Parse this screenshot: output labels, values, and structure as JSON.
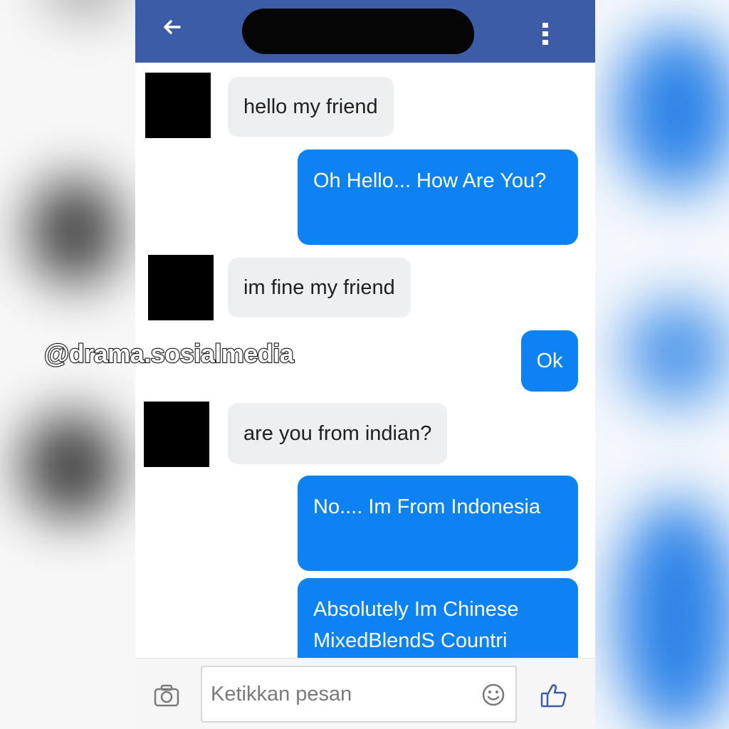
{
  "conversation": {
    "messages": [
      {
        "sender": "contact",
        "text": "hello my friend"
      },
      {
        "sender": "me",
        "text": "Oh Hello... How Are You?"
      },
      {
        "sender": "contact",
        "text": "im fine my friend"
      },
      {
        "sender": "me",
        "text": "Ok"
      },
      {
        "sender": "contact",
        "text": "are you from indian?"
      },
      {
        "sender": "me",
        "text": "No.... Im From Indonesia"
      },
      {
        "sender": "me",
        "text": "Absolutely Im Chinese MixedBlendS Countri"
      }
    ]
  },
  "composer": {
    "placeholder": "Ketikkan pesan"
  },
  "watermark": "@drama.sosialmedia",
  "icons": {
    "back": "back-arrow-icon",
    "more": "more-vertical-icon",
    "camera": "camera-icon",
    "emoji": "emoji-icon",
    "like": "thumbs-up-icon"
  },
  "colors": {
    "header": "#3b5da8",
    "outgoing_bubble": "#0d83f3",
    "incoming_bubble": "#eeeff1",
    "side_blur_right": "#1877e6"
  }
}
